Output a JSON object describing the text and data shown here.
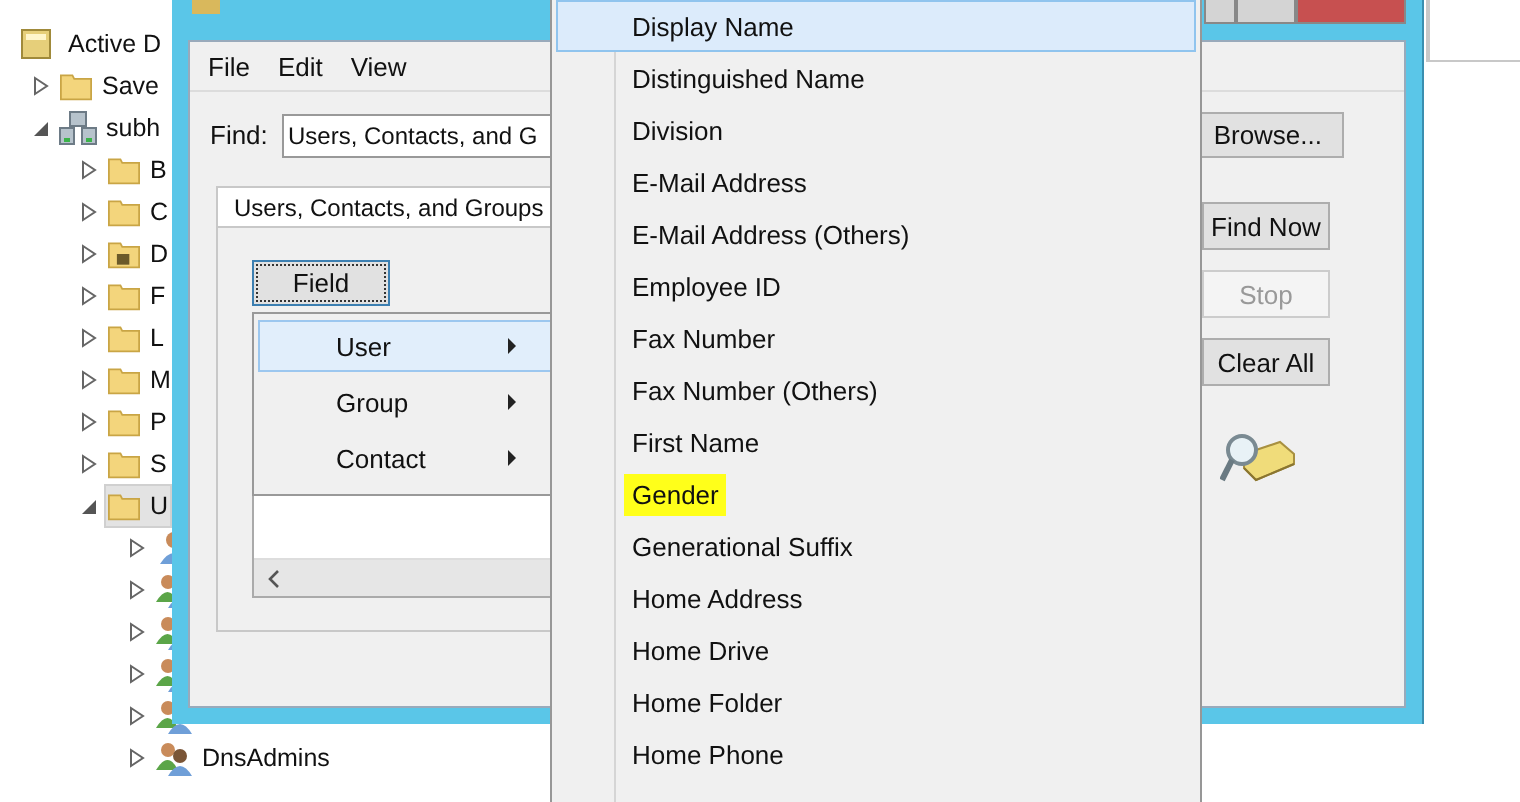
{
  "tree": {
    "root": {
      "label": "Active D",
      "children": [
        {
          "label": "Save",
          "kind": "folder",
          "expanded": false,
          "selected": false
        },
        {
          "label": "subh",
          "kind": "domain",
          "expanded": true,
          "selected": false,
          "children": [
            {
              "label": "B",
              "kind": "folder",
              "expanded": false,
              "selected": false
            },
            {
              "label": "C",
              "kind": "folder",
              "expanded": false,
              "selected": false
            },
            {
              "label": "D",
              "kind": "special-folder",
              "expanded": false,
              "selected": false
            },
            {
              "label": "F",
              "kind": "folder",
              "expanded": false,
              "selected": false
            },
            {
              "label": "L",
              "kind": "folder",
              "expanded": false,
              "selected": false
            },
            {
              "label": "M",
              "kind": "folder",
              "expanded": false,
              "selected": false
            },
            {
              "label": "P",
              "kind": "folder",
              "expanded": false,
              "selected": false
            },
            {
              "label": "S",
              "kind": "folder",
              "expanded": false,
              "selected": false
            },
            {
              "label": "U",
              "kind": "folder",
              "expanded": true,
              "selected": true,
              "children": [
                {
                  "kind": "user",
                  "expanded": false,
                  "selected": false
                },
                {
                  "kind": "group",
                  "expanded": false,
                  "selected": false
                },
                {
                  "kind": "group",
                  "expanded": false,
                  "selected": false
                },
                {
                  "kind": "group",
                  "expanded": false,
                  "selected": false
                },
                {
                  "kind": "group",
                  "expanded": false,
                  "selected": false
                },
                {
                  "label": "DnsAdmins",
                  "kind": "group",
                  "expanded": false,
                  "selected": false
                }
              ]
            }
          ]
        }
      ]
    }
  },
  "dialog": {
    "menu": [
      "File",
      "Edit",
      "View"
    ],
    "find": {
      "label": "Find:",
      "value": "Users, Contacts, and G"
    },
    "browse_button": "Browse...",
    "tabs": [
      {
        "label": "Users, Contacts, and Groups",
        "selected": true
      }
    ],
    "field_button": "Field",
    "field_menu": [
      {
        "label": "User",
        "selected": true
      },
      {
        "label": "Group",
        "selected": false
      },
      {
        "label": "Contact",
        "selected": false
      }
    ],
    "actions": [
      {
        "label": "Find Now",
        "disabled": false
      },
      {
        "label": "Stop",
        "disabled": true
      },
      {
        "label": "Clear All",
        "disabled": false
      }
    ]
  },
  "attribute_menu": {
    "items": [
      {
        "label": "Display Name",
        "selected": true,
        "highlighted": false
      },
      {
        "label": "Distinguished Name",
        "selected": false,
        "highlighted": false
      },
      {
        "label": "Division",
        "selected": false,
        "highlighted": false
      },
      {
        "label": "E-Mail Address",
        "selected": false,
        "highlighted": false
      },
      {
        "label": "E-Mail Address (Others)",
        "selected": false,
        "highlighted": false
      },
      {
        "label": "Employee ID",
        "selected": false,
        "highlighted": false
      },
      {
        "label": "Fax Number",
        "selected": false,
        "highlighted": false
      },
      {
        "label": "Fax Number (Others)",
        "selected": false,
        "highlighted": false
      },
      {
        "label": "First Name",
        "selected": false,
        "highlighted": false
      },
      {
        "label": "Gender",
        "selected": false,
        "highlighted": true
      },
      {
        "label": "Generational Suffix",
        "selected": false,
        "highlighted": false
      },
      {
        "label": "Home Address",
        "selected": false,
        "highlighted": false
      },
      {
        "label": "Home Drive",
        "selected": false,
        "highlighted": false
      },
      {
        "label": "Home Folder",
        "selected": false,
        "highlighted": false
      },
      {
        "label": "Home Phone",
        "selected": false,
        "highlighted": false
      }
    ]
  }
}
